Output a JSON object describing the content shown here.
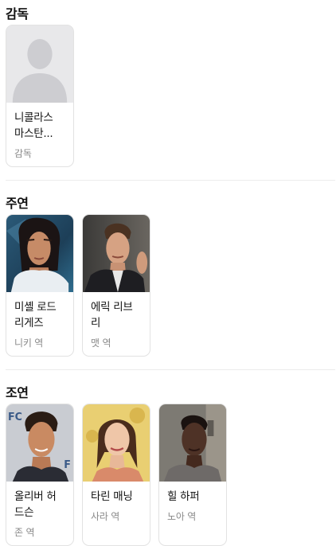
{
  "director_section": {
    "title": "감독",
    "people": [
      {
        "name_line1": "니콜라스",
        "name_line2": "마스탄...",
        "role": "감독",
        "photo": "placeholder-avatar-icon"
      }
    ]
  },
  "lead_section": {
    "title": "주연",
    "people": [
      {
        "name_line1": "미셸 로드",
        "name_line2": "리게즈",
        "role": "니키 역"
      },
      {
        "name_line1": "에릭 리브",
        "name_line2": "리",
        "role": "맷 역"
      }
    ]
  },
  "supporting_section": {
    "title": "조연",
    "people": [
      {
        "name_line1": "올리버 허",
        "name_line2": "드슨",
        "role": "존 역"
      },
      {
        "name_line1": "타린 매닝",
        "name_line2": "",
        "role": "사라 역"
      },
      {
        "name_line1": "힐 하퍼",
        "name_line2": "",
        "role": "노아 역"
      }
    ]
  },
  "colors": {
    "card_border": "#e2e2e2",
    "role_text": "#8a8a8a",
    "placeholder_bg": "#e8e8ea",
    "placeholder_silhouette": "#cdcdd1"
  }
}
